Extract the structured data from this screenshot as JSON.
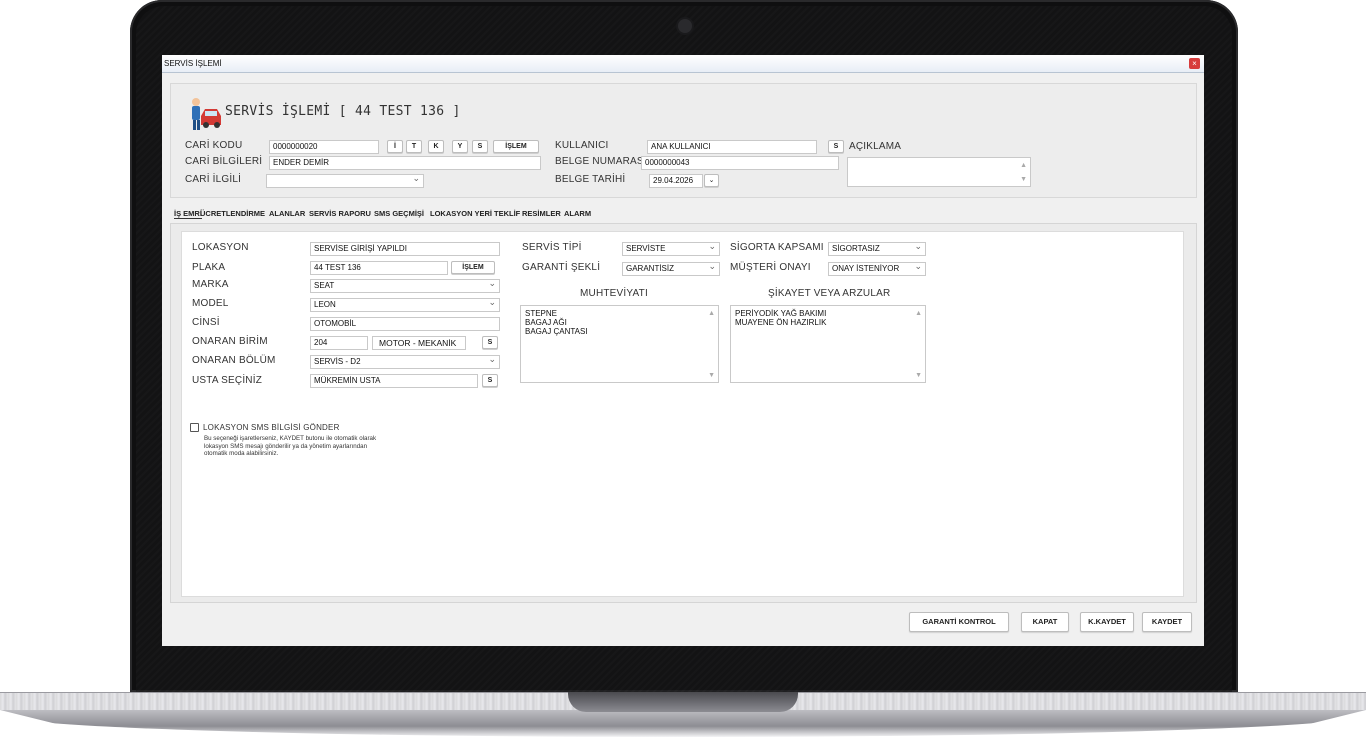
{
  "window": {
    "title": "SERVİS İŞLEMİ",
    "close_glyph": "×"
  },
  "header": {
    "title": "SERVİS İŞLEMİ [ 44 TEST 136 ]",
    "icon": "mechanic-car-icon"
  },
  "top_form": {
    "cari_kodu": {
      "label": "CARİ KODU",
      "value": "0000000020"
    },
    "cari_buttons": [
      "İ",
      "T",
      "K",
      "Y",
      "S",
      "İŞLEM"
    ],
    "cari_bilgileri": {
      "label": "CARİ BİLGİLERİ",
      "value": "ENDER DEMİR"
    },
    "cari_ilgili": {
      "label": "CARİ İLGİLİ",
      "value": ""
    },
    "kullanici": {
      "label": "KULLANICI",
      "value": "ANA KULLANICI",
      "button": "S"
    },
    "belge_numarasi": {
      "label": "BELGE NUMARASI",
      "value": "0000000043"
    },
    "belge_tarihi": {
      "label": "BELGE TARİHİ",
      "value": "29.04.2026"
    },
    "aciklama": {
      "label": "AÇIKLAMA",
      "value": ""
    }
  },
  "tabs": [
    "İŞ EMRİ",
    "ÜCRETLENDİRME",
    "ALANLAR",
    "SERVİS RAPORU",
    "SMS GEÇMİŞİ",
    "LOKASYON YERİ",
    "TEKLİF",
    "RESİMLER",
    "ALARM"
  ],
  "is_emri": {
    "lokasyon": {
      "label": "LOKASYON",
      "value": "SERVİSE GİRİŞİ YAPILDI"
    },
    "plaka": {
      "label": "PLAKA",
      "value": "44 TEST 136",
      "button": "İŞLEM"
    },
    "marka": {
      "label": "MARKA",
      "value": "SEAT"
    },
    "model": {
      "label": "MODEL",
      "value": "LEON"
    },
    "cinsi": {
      "label": "CİNSİ",
      "value": "OTOMOBİL"
    },
    "onaran_birim": {
      "label": "ONARAN BİRİM",
      "code": "204",
      "value": "MOTOR - MEKANİK",
      "button": "S"
    },
    "onaran_bolum": {
      "label": "ONARAN BÖLÜM",
      "value": "SERVİS - D2"
    },
    "usta": {
      "label": "USTA SEÇİNİZ",
      "value": "MÜKREMİN USTA",
      "button": "S"
    },
    "servis_tipi": {
      "label": "SERVİS TİPİ",
      "value": "SERVİSTE"
    },
    "garanti_sekli": {
      "label": "GARANTİ ŞEKLİ",
      "value": "GARANTİSİZ"
    },
    "sigorta_kapsami": {
      "label": "SİGORTA KAPSAMI",
      "value": "SİGORTASIZ"
    },
    "musteri_onayi": {
      "label": "MÜŞTERİ ONAYI",
      "value": "ONAY İSTENİYOR"
    },
    "muhteviyati": {
      "label": "MUHTEVİYATI",
      "lines": [
        "STEPNE",
        "BAGAJ AĞI",
        "BAGAJ ÇANTASI"
      ]
    },
    "sikayet": {
      "label": "ŞİKAYET VEYA ARZULAR",
      "lines": [
        "PERİYODİK YAĞ BAKIMI",
        "MUAYENE ÖN HAZIRLIK"
      ]
    },
    "sms": {
      "label": "LOKASYON SMS BİLGİSİ GÖNDER",
      "checked": false,
      "help": [
        "Bu seçeneği işaretlerseniz, KAYDET butonu ile otomatik olarak",
        "lokasyon SMS mesajı gönderilir ya da yönetim ayarlarından",
        "otomatik moda alabilirsiniz."
      ]
    }
  },
  "footer": {
    "garanti": "GARANTİ KONTROL",
    "kapat": "KAPAT",
    "kkaydet": "K.KAYDET",
    "kaydet": "KAYDET"
  }
}
